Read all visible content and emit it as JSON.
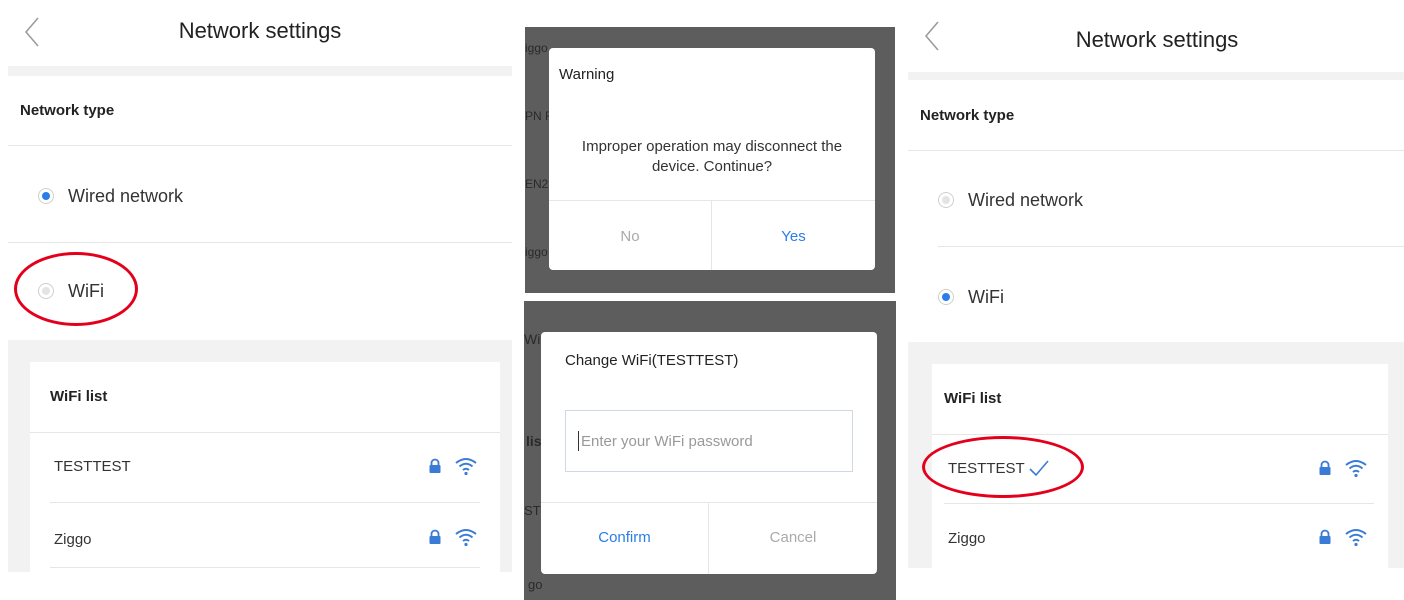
{
  "screens": {
    "left": {
      "header_title": "Network settings",
      "network_type_label": "Network type",
      "options": [
        "Wired network",
        "WiFi"
      ],
      "wifi_list_title": "WiFi list",
      "wifi_list": [
        "TESTTEST",
        "Ziggo"
      ]
    },
    "right": {
      "header_title": "Network settings",
      "network_type_label": "Network type",
      "options": [
        "Wired network",
        "WiFi"
      ],
      "wifi_list_title": "WiFi list",
      "wifi_list": [
        "TESTTEST",
        "Ziggo"
      ]
    }
  },
  "warning_dialog": {
    "title": "Warning",
    "message_line1": "Improper operation may disconnect the",
    "message_line2": "device. Continue?",
    "no_label": "No",
    "yes_label": "Yes",
    "background_fragments": [
      "iggo",
      "PN F",
      "EN2",
      "iggo"
    ]
  },
  "change_wifi_dialog": {
    "title": "Change WiFi(TESTTEST)",
    "password_placeholder": "Enter your WiFi password",
    "confirm_label": "Confirm",
    "cancel_label": "Cancel",
    "background_fragments": [
      "Wif",
      "lis",
      "STT",
      "go"
    ]
  },
  "colors": {
    "accent_blue": "#2b7de9",
    "highlight_red": "#e4001b",
    "dim_overlay": "#5d5d5d"
  },
  "icons": [
    "back-arrow-icon",
    "lock-icon",
    "wifi-signal-icon",
    "checkmark-icon"
  ]
}
